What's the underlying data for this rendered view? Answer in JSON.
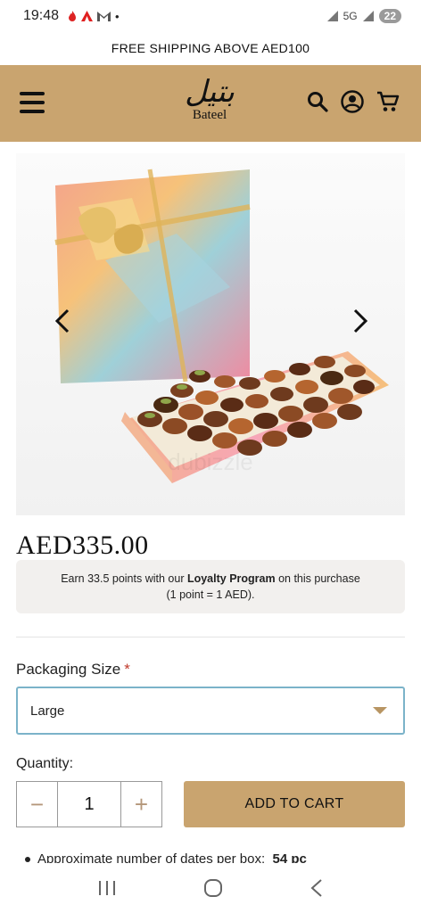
{
  "status_bar": {
    "time": "19:48",
    "network": "5G",
    "battery": "22"
  },
  "promo": {
    "text": "FREE SHIPPING ABOVE AED100"
  },
  "header": {
    "logo_arabic": "بتيل",
    "logo_text": "Bateel",
    "accent_color": "#c9a46f"
  },
  "product": {
    "price": "AED335.00",
    "loyalty_prefix": "Earn 33.5 points with our ",
    "loyalty_link": "Loyalty Program",
    "loyalty_suffix": " on this purchase",
    "loyalty_note": "(1 point = 1 AED)."
  },
  "options": {
    "packaging_label": "Packaging Size",
    "required_mark": "*",
    "packaging_selected": "Large"
  },
  "quantity": {
    "label": "Quantity:",
    "value": "1",
    "decrement": "−",
    "increment": "+"
  },
  "cart": {
    "button_label": "ADD TO CART"
  },
  "details": {
    "first_bullet": "Approximate number of dates per box:",
    "first_bullet_value": "54 pc"
  }
}
